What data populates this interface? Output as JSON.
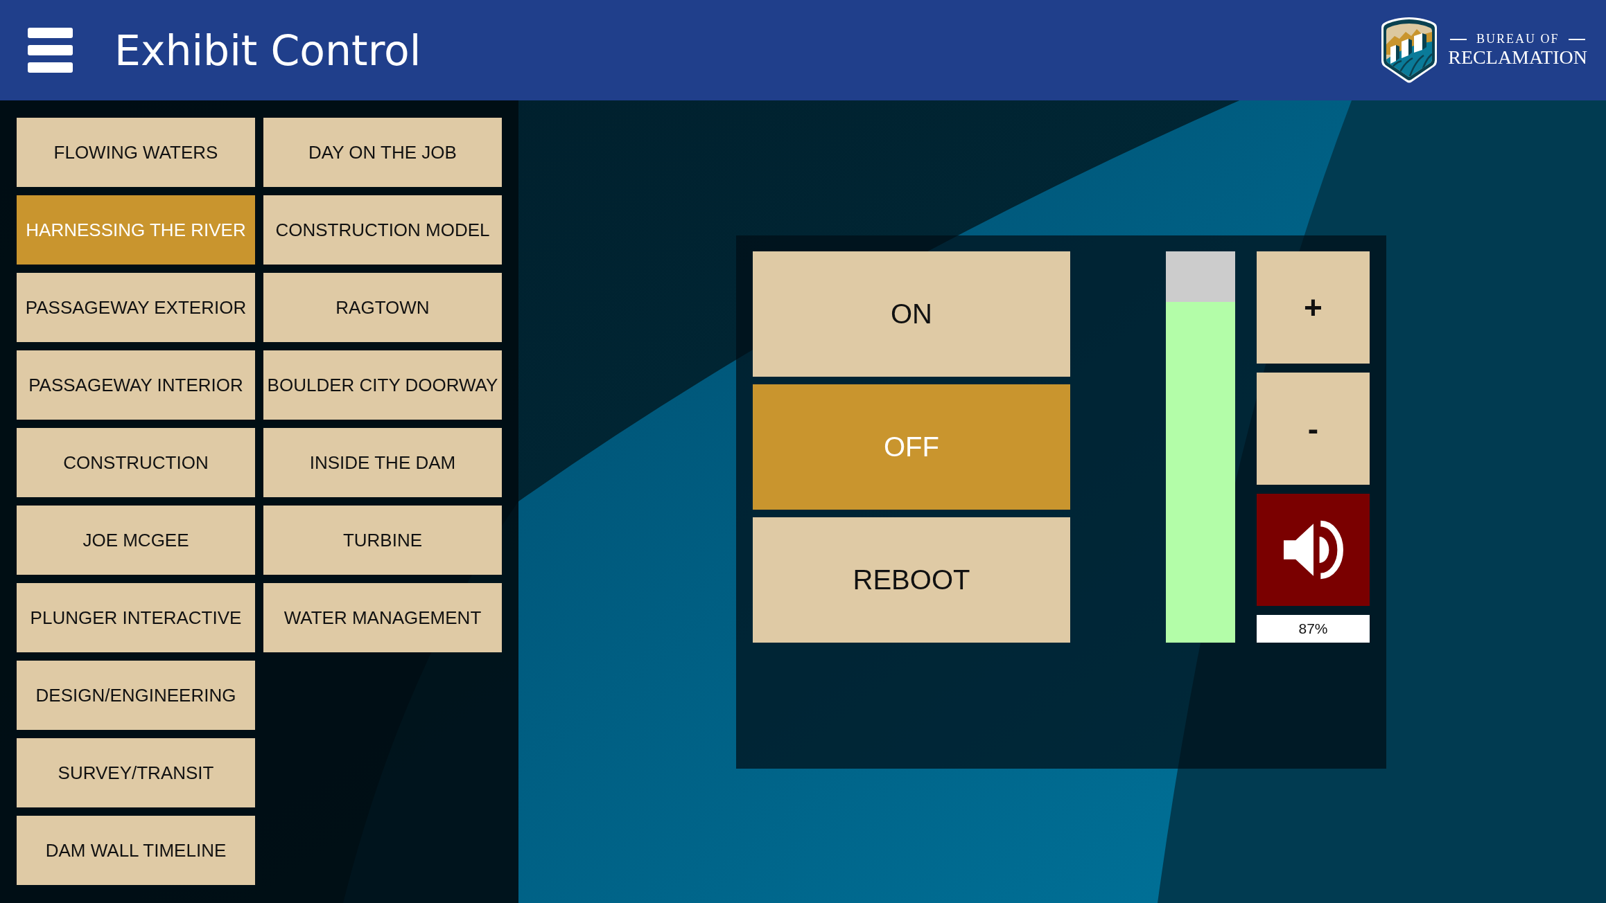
{
  "header": {
    "title": "Exhibit Control",
    "logo": {
      "line_1": "BUREAU OF",
      "line_2": "RECLAMATION"
    }
  },
  "exhibit_columns": [
    {
      "items": [
        {
          "label": "FLOWING WATERS",
          "selected": false
        },
        {
          "label": "HARNESSING THE RIVER",
          "selected": true
        },
        {
          "label": "PASSAGEWAY EXTERIOR",
          "selected": false
        },
        {
          "label": "PASSAGEWAY INTERIOR",
          "selected": false
        },
        {
          "label": "CONSTRUCTION",
          "selected": false
        },
        {
          "label": "JOE MCGEE",
          "selected": false
        },
        {
          "label": "PLUNGER INTERACTIVE",
          "selected": false
        },
        {
          "label": "DESIGN/ENGINEERING",
          "selected": false
        },
        {
          "label": "SURVEY/TRANSIT",
          "selected": false
        },
        {
          "label": "DAM WALL TIMELINE",
          "selected": false
        }
      ]
    },
    {
      "items": [
        {
          "label": "DAY ON THE JOB",
          "selected": false
        },
        {
          "label": "CONSTRUCTION MODEL",
          "selected": false
        },
        {
          "label": "RAGTOWN",
          "selected": false
        },
        {
          "label": "BOULDER CITY DOORWAY",
          "selected": false
        },
        {
          "label": "INSIDE THE DAM",
          "selected": false
        },
        {
          "label": "TURBINE",
          "selected": false
        },
        {
          "label": "WATER MANAGEMENT",
          "selected": false
        }
      ]
    }
  ],
  "power_buttons": [
    {
      "label": "ON",
      "selected": false
    },
    {
      "label": "OFF",
      "selected": true
    },
    {
      "label": "REBOOT",
      "selected": false
    }
  ],
  "volume": {
    "level": 0.87,
    "reading": "87%",
    "up_label": "+",
    "down_label": "-",
    "muted": false
  }
}
